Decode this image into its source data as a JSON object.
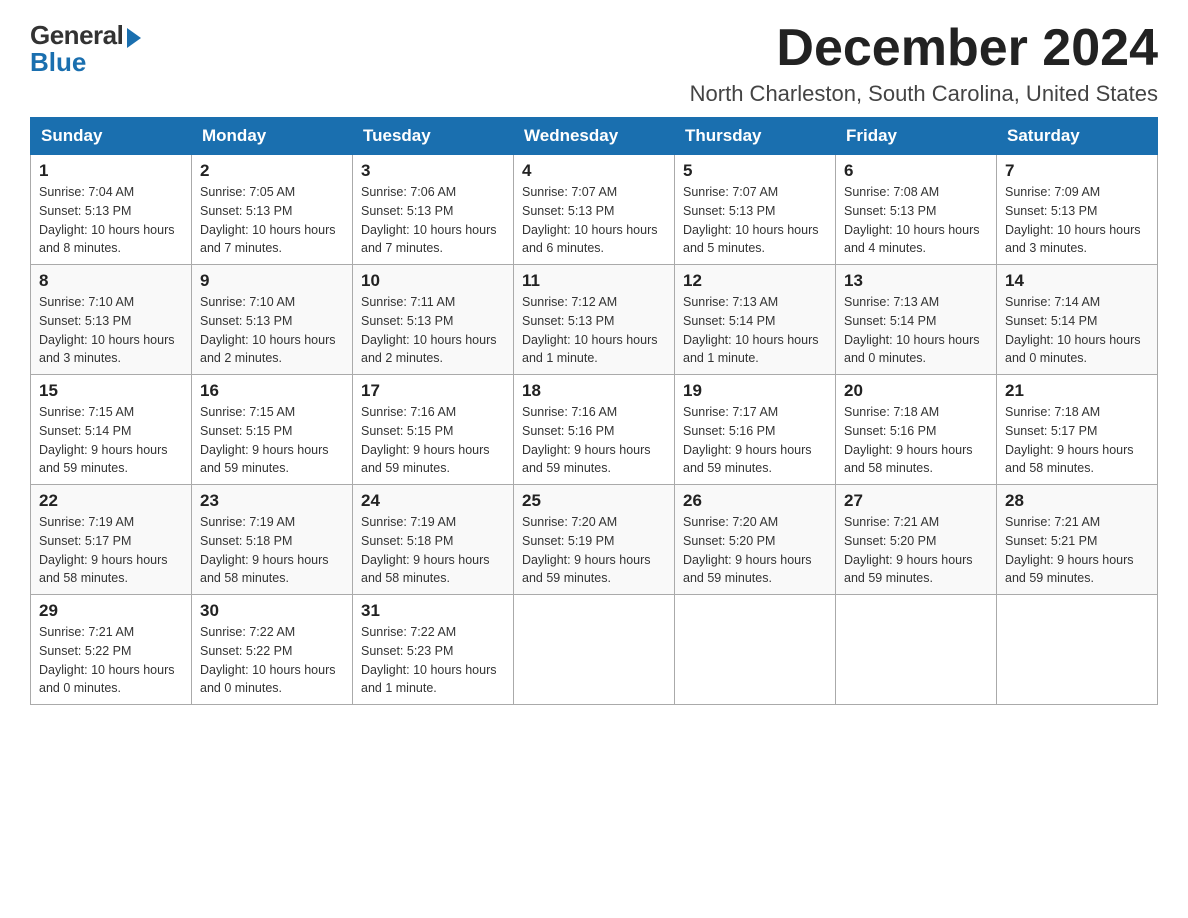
{
  "logo": {
    "general_text": "General",
    "blue_text": "Blue"
  },
  "header": {
    "month_year": "December 2024",
    "location": "North Charleston, South Carolina, United States"
  },
  "days_of_week": [
    "Sunday",
    "Monday",
    "Tuesday",
    "Wednesday",
    "Thursday",
    "Friday",
    "Saturday"
  ],
  "weeks": [
    [
      {
        "day": "1",
        "sunrise": "7:04 AM",
        "sunset": "5:13 PM",
        "daylight": "10 hours and 8 minutes."
      },
      {
        "day": "2",
        "sunrise": "7:05 AM",
        "sunset": "5:13 PM",
        "daylight": "10 hours and 7 minutes."
      },
      {
        "day": "3",
        "sunrise": "7:06 AM",
        "sunset": "5:13 PM",
        "daylight": "10 hours and 7 minutes."
      },
      {
        "day": "4",
        "sunrise": "7:07 AM",
        "sunset": "5:13 PM",
        "daylight": "10 hours and 6 minutes."
      },
      {
        "day": "5",
        "sunrise": "7:07 AM",
        "sunset": "5:13 PM",
        "daylight": "10 hours and 5 minutes."
      },
      {
        "day": "6",
        "sunrise": "7:08 AM",
        "sunset": "5:13 PM",
        "daylight": "10 hours and 4 minutes."
      },
      {
        "day": "7",
        "sunrise": "7:09 AM",
        "sunset": "5:13 PM",
        "daylight": "10 hours and 3 minutes."
      }
    ],
    [
      {
        "day": "8",
        "sunrise": "7:10 AM",
        "sunset": "5:13 PM",
        "daylight": "10 hours and 3 minutes."
      },
      {
        "day": "9",
        "sunrise": "7:10 AM",
        "sunset": "5:13 PM",
        "daylight": "10 hours and 2 minutes."
      },
      {
        "day": "10",
        "sunrise": "7:11 AM",
        "sunset": "5:13 PM",
        "daylight": "10 hours and 2 minutes."
      },
      {
        "day": "11",
        "sunrise": "7:12 AM",
        "sunset": "5:13 PM",
        "daylight": "10 hours and 1 minute."
      },
      {
        "day": "12",
        "sunrise": "7:13 AM",
        "sunset": "5:14 PM",
        "daylight": "10 hours and 1 minute."
      },
      {
        "day": "13",
        "sunrise": "7:13 AM",
        "sunset": "5:14 PM",
        "daylight": "10 hours and 0 minutes."
      },
      {
        "day": "14",
        "sunrise": "7:14 AM",
        "sunset": "5:14 PM",
        "daylight": "10 hours and 0 minutes."
      }
    ],
    [
      {
        "day": "15",
        "sunrise": "7:15 AM",
        "sunset": "5:14 PM",
        "daylight": "9 hours and 59 minutes."
      },
      {
        "day": "16",
        "sunrise": "7:15 AM",
        "sunset": "5:15 PM",
        "daylight": "9 hours and 59 minutes."
      },
      {
        "day": "17",
        "sunrise": "7:16 AM",
        "sunset": "5:15 PM",
        "daylight": "9 hours and 59 minutes."
      },
      {
        "day": "18",
        "sunrise": "7:16 AM",
        "sunset": "5:16 PM",
        "daylight": "9 hours and 59 minutes."
      },
      {
        "day": "19",
        "sunrise": "7:17 AM",
        "sunset": "5:16 PM",
        "daylight": "9 hours and 59 minutes."
      },
      {
        "day": "20",
        "sunrise": "7:18 AM",
        "sunset": "5:16 PM",
        "daylight": "9 hours and 58 minutes."
      },
      {
        "day": "21",
        "sunrise": "7:18 AM",
        "sunset": "5:17 PM",
        "daylight": "9 hours and 58 minutes."
      }
    ],
    [
      {
        "day": "22",
        "sunrise": "7:19 AM",
        "sunset": "5:17 PM",
        "daylight": "9 hours and 58 minutes."
      },
      {
        "day": "23",
        "sunrise": "7:19 AM",
        "sunset": "5:18 PM",
        "daylight": "9 hours and 58 minutes."
      },
      {
        "day": "24",
        "sunrise": "7:19 AM",
        "sunset": "5:18 PM",
        "daylight": "9 hours and 58 minutes."
      },
      {
        "day": "25",
        "sunrise": "7:20 AM",
        "sunset": "5:19 PM",
        "daylight": "9 hours and 59 minutes."
      },
      {
        "day": "26",
        "sunrise": "7:20 AM",
        "sunset": "5:20 PM",
        "daylight": "9 hours and 59 minutes."
      },
      {
        "day": "27",
        "sunrise": "7:21 AM",
        "sunset": "5:20 PM",
        "daylight": "9 hours and 59 minutes."
      },
      {
        "day": "28",
        "sunrise": "7:21 AM",
        "sunset": "5:21 PM",
        "daylight": "9 hours and 59 minutes."
      }
    ],
    [
      {
        "day": "29",
        "sunrise": "7:21 AM",
        "sunset": "5:22 PM",
        "daylight": "10 hours and 0 minutes."
      },
      {
        "day": "30",
        "sunrise": "7:22 AM",
        "sunset": "5:22 PM",
        "daylight": "10 hours and 0 minutes."
      },
      {
        "day": "31",
        "sunrise": "7:22 AM",
        "sunset": "5:23 PM",
        "daylight": "10 hours and 1 minute."
      },
      null,
      null,
      null,
      null
    ]
  ]
}
